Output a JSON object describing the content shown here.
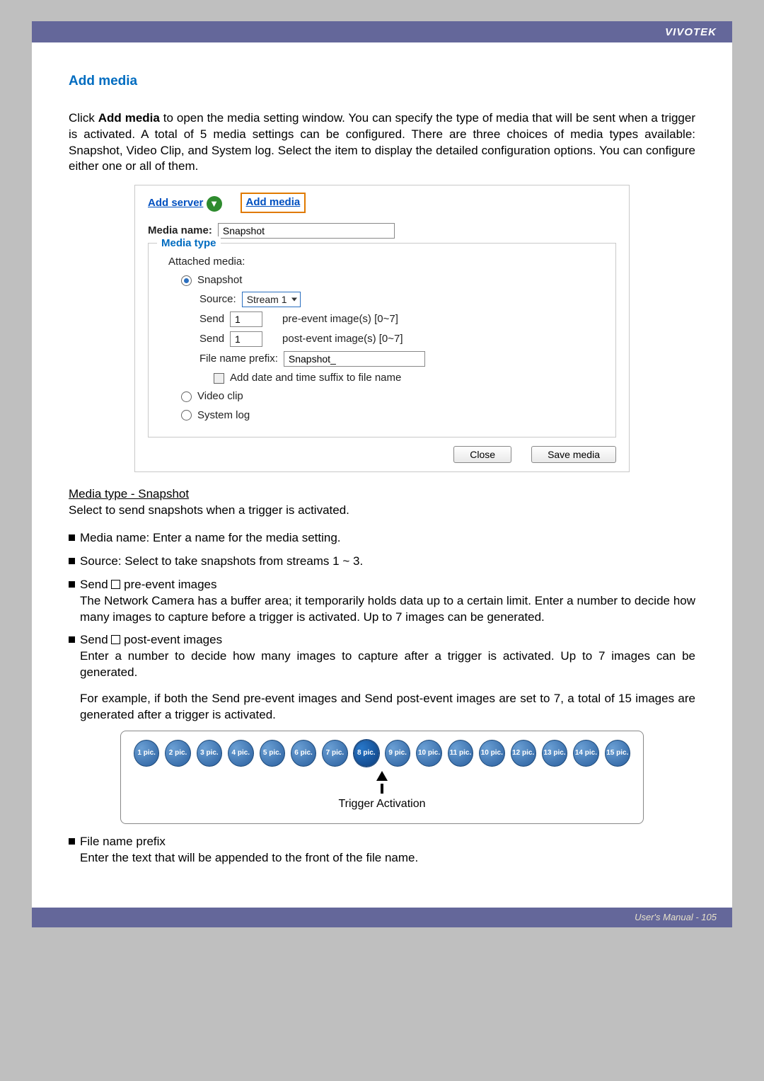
{
  "brand": "VIVOTEK",
  "section_title": "Add media",
  "intro_prefix": "Click ",
  "intro_bold": "Add media",
  "intro_rest": " to open the media setting window. You can specify the type of media that will be sent when a trigger is activated. A total of 5 media settings can be configured. There are three choices of media types available: Snapshot, Video Clip, and System log. Select the item to display the detailed configuration options. You can configure either one or all of them.",
  "panel": {
    "tab_add_server": "Add server",
    "tab_add_media": "Add media",
    "media_name_label": "Media name:",
    "media_name_value": "Snapshot",
    "legend": "Media type",
    "attached_media_label": "Attached media:",
    "radio_snapshot": "Snapshot",
    "source_label": "Source:",
    "source_value": "Stream 1",
    "send_label": "Send",
    "pre_value": "1",
    "pre_suffix": "pre-event image(s) [0~7]",
    "post_value": "1",
    "post_suffix": "post-event image(s) [0~7]",
    "prefix_label": "File name prefix:",
    "prefix_value": "Snapshot_",
    "suffix_checkbox_label": "Add date and time suffix to file name",
    "radio_video": "Video clip",
    "radio_syslog": "System log",
    "btn_close": "Close",
    "btn_save": "Save media"
  },
  "subhead": "Media type - Snapshot",
  "subhead_line": "Select to send snapshots when a trigger is activated.",
  "bullets": {
    "b1": "Media name: Enter a name for the media setting.",
    "b2": "Source: Select to take snapshots from streams 1 ~ 3.",
    "b3_label": "Send ",
    "b3_after": " pre-event images",
    "b3_body": "The Network Camera has a buffer area; it temporarily holds data up to a certain limit. Enter a number to decide how many images to capture before a trigger is activated. Up to 7 images can be generated.",
    "b4_label": "Send ",
    "b4_after": " post-event images",
    "b4_body1": "Enter a number to decide how many images to capture after a trigger is activated. Up to 7 images can be generated.",
    "b4_body2": "For example, if both the Send pre-event images and Send post-event images are set to 7, a total of 15 images are generated after a trigger is activated.",
    "b5_title": "File name prefix",
    "b5_body": "Enter the text that will be appended to the front of the file name."
  },
  "diagram": {
    "labels": [
      "1 pic.",
      "2 pic.",
      "3 pic.",
      "4 pic.",
      "5 pic.",
      "6 pic.",
      "7 pic.",
      "8 pic.",
      "9 pic.",
      "10 pic.",
      "11 pic.",
      "10 pic.",
      "12 pic.",
      "13 pic.",
      "14 pic.",
      "15 pic."
    ],
    "focus_index": 7,
    "caption": "Trigger Activation"
  },
  "footer": "User's Manual - 105"
}
